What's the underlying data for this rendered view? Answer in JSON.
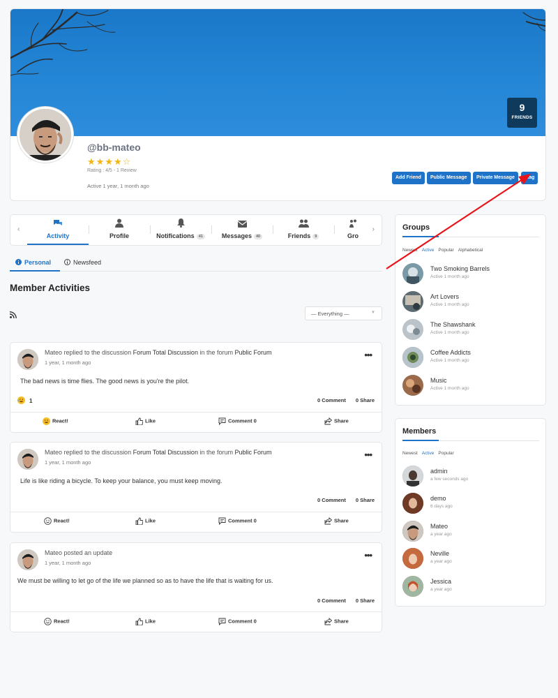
{
  "profile": {
    "username": "@bb-mateo",
    "rating_stars": 4,
    "rating_max": 5,
    "rating_text": "Rating : 4/5 - 1 Review",
    "active_text": "Active 1 year, 1 month ago",
    "friends_count": "9",
    "friends_label": "FRIENDS",
    "buttons": {
      "add_friend": "Add Friend",
      "public_message": "Public Message",
      "private_message": "Private Message",
      "flag": "Flag"
    }
  },
  "tabs": [
    {
      "label": "Activity",
      "icon": "chat-bubbles-icon",
      "active": true
    },
    {
      "label": "Profile",
      "icon": "user-icon"
    },
    {
      "label": "Notifications",
      "icon": "bell-icon",
      "badge": "41"
    },
    {
      "label": "Messages",
      "icon": "envelope-icon",
      "badge": "40"
    },
    {
      "label": "Friends",
      "icon": "users-icon",
      "badge": "9"
    },
    {
      "label": "Gro",
      "icon": "groups-icon"
    }
  ],
  "subtabs": {
    "personal": "Personal",
    "newsfeed": "Newsfeed"
  },
  "section_title": "Member Activities",
  "filter": {
    "selected": "— Everything —"
  },
  "activities": [
    {
      "header_actor": "Mateo",
      "header_action": " replied to the discussion ",
      "header_topic": "Forum Total Discussion",
      "header_mid": " in the forum ",
      "header_forum": "Public Forum",
      "time": "1 year, 1 month ago",
      "text": "The bad news is time flies. The good news is you're the pilot.",
      "react_count": "1",
      "comments": "0 Comment",
      "shares": "0 Share",
      "react_label": "React!",
      "like_label": "Like",
      "comment_label": "Comment 0",
      "share_label": "Share"
    },
    {
      "header_actor": "Mateo",
      "header_action": " replied to the discussion ",
      "header_topic": "Forum Total Discussion",
      "header_mid": " in the forum ",
      "header_forum": "Public Forum",
      "time": "1 year, 1 month ago",
      "text": "Life is like riding a bicycle. To keep your balance, you must keep moving.",
      "comments": "0 Comment",
      "shares": "0 Share",
      "react_label": "React!",
      "like_label": "Like",
      "comment_label": "Comment 0",
      "share_label": "Share"
    },
    {
      "header_actor": "Mateo",
      "header_action": " posted an update",
      "time": "1 year, 1 month ago",
      "text": "We must be willing to let go of the life we planned so as to have the life that is waiting for us.",
      "comments": "0 Comment",
      "shares": "0 Share",
      "react_label": "React!",
      "like_label": "Like",
      "comment_label": "Comment 0",
      "share_label": "Share"
    }
  ],
  "groups_widget": {
    "title": "Groups",
    "filters": [
      "Newest",
      "Active",
      "Popular",
      "Alphabetical"
    ],
    "active_filter": "Active",
    "items": [
      {
        "name": "Two Smoking Barrels",
        "sub": "Active 1 month ago",
        "color": "#7a9aa8"
      },
      {
        "name": "Art Lovers",
        "sub": "Active 1 month ago",
        "color": "#5d6b73"
      },
      {
        "name": "The Shawshank",
        "sub": "Active 1 month ago",
        "color": "#b9c3c9"
      },
      {
        "name": "Coffee Addicts",
        "sub": "Active 1 month ago",
        "color": "#6f8c5a"
      },
      {
        "name": "Music",
        "sub": "Active 1 month ago",
        "color": "#9b6a4a"
      }
    ]
  },
  "members_widget": {
    "title": "Members",
    "filters": [
      "Newest",
      "Active",
      "Popular"
    ],
    "active_filter": "Active",
    "items": [
      {
        "name": "admin",
        "sub": "a few seconds ago",
        "color": "#6b625c"
      },
      {
        "name": "demo",
        "sub": "6 days ago",
        "color": "#8a4a32"
      },
      {
        "name": "Mateo",
        "sub": "a year ago",
        "color": "#4a3f38"
      },
      {
        "name": "Neville",
        "sub": "a year ago",
        "color": "#b25a3a"
      },
      {
        "name": "Jessica",
        "sub": "a year ago",
        "color": "#c77b5f"
      }
    ]
  },
  "colors": {
    "accent": "#1e73c9",
    "cover": "#2486d6",
    "friends_box": "#0f3a5c",
    "annotation_arrow": "#e8141b"
  }
}
